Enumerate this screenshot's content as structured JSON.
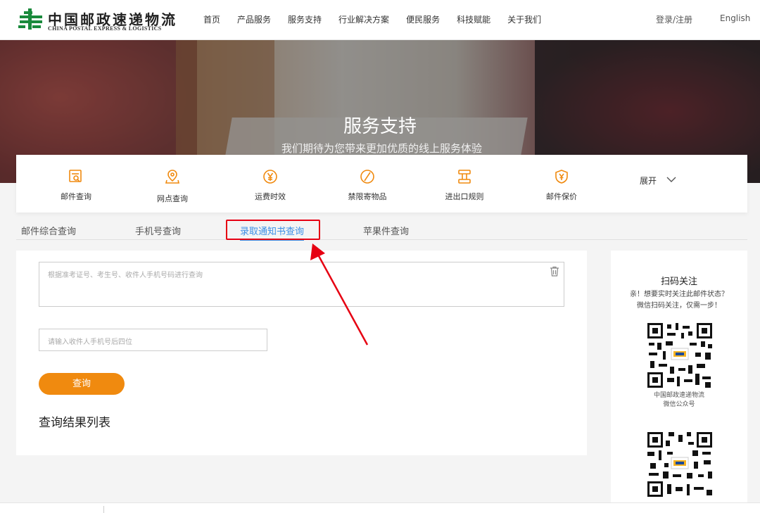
{
  "header": {
    "logo_cn": "中国邮政速递物流",
    "logo_en": "CHINA POSTAL EXPRESS & LOGISTICS",
    "nav": [
      "首页",
      "产品服务",
      "服务支持",
      "行业解决方案",
      "便民服务",
      "科技赋能",
      "关于我们"
    ],
    "login": "登录/注册",
    "lang": "English"
  },
  "banner": {
    "title": "服务支持",
    "subtitle": "我们期待为您带来更加优质的线上服务体验"
  },
  "services": [
    {
      "label": "邮件查询",
      "icon": "mail-search-icon"
    },
    {
      "label": "网点查询",
      "icon": "location-pin-icon"
    },
    {
      "label": "运费时效",
      "icon": "yen-coin-icon"
    },
    {
      "label": "禁限寄物品",
      "icon": "prohibited-icon"
    },
    {
      "label": "进出口规则",
      "icon": "rules-icon"
    },
    {
      "label": "邮件保价",
      "icon": "shield-yen-icon"
    }
  ],
  "expand_label": "展开",
  "tabs": [
    "邮件综合查询",
    "手机号查询",
    "录取通知书查询",
    "苹果件查询"
  ],
  "active_tab": "录取通知书查询",
  "form": {
    "textarea_placeholder": "根据准考证号、考生号、收件人手机号码进行查询",
    "phone_placeholder": "请输入收件人手机号后四位",
    "query_button": "查询",
    "result_title": "查询结果列表"
  },
  "sidebar": {
    "title": "扫码关注",
    "desc_line1": "亲！想要实时关注此邮件状态？",
    "desc_line2": "微信扫码关注，仅需一步！",
    "qr1_caption_line1": "中国邮政速递物流",
    "qr1_caption_line2": "微信公众号"
  },
  "colors": {
    "accent_orange": "#f08a0f",
    "tab_blue": "#3a8ee6",
    "annotation_red": "#e60012",
    "logo_green": "#1a8a3c"
  }
}
